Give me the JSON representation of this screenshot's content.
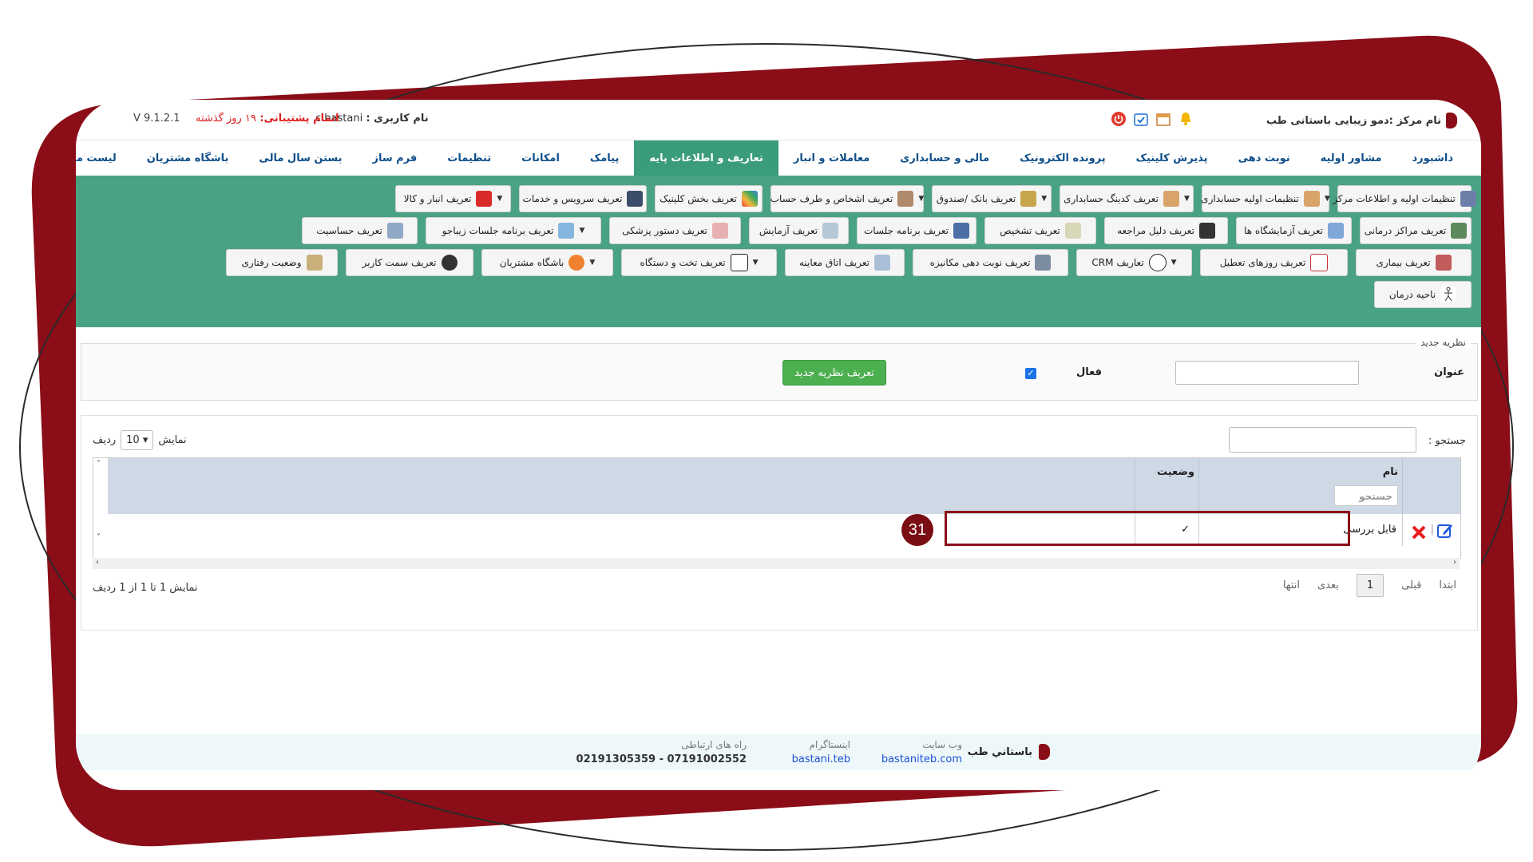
{
  "colors": {
    "brand": "#8b0d17",
    "menu_green": "#4aa285",
    "active_tab": "#3b9c7a",
    "link_blue": "#0f4f8a"
  },
  "topbar": {
    "center_name": "نام مرکز :دمو زیبایی باستانی طب",
    "username_label": "نام کاربری :",
    "username": "c.bastani",
    "support_label": "اتمام پشتیبانی:",
    "support_days": "۱۹ روز گذشته",
    "version": "V 9.1.2.1",
    "icons": [
      "bell-icon",
      "calendar-icon",
      "calendar-check-icon",
      "power-icon"
    ]
  },
  "mainnav": {
    "items": [
      "داشبورد",
      "مشاور اولیه",
      "نوبت دهی",
      "پذیرش کلینیک",
      "پرونده الکترونیک",
      "مالی و حسابداری",
      "معاملات و انبار",
      "تعاریف و اطلاعات پایه",
      "پیامک",
      "امکانات",
      "تنظیمات",
      "فرم ساز",
      "بستن سال مالی",
      "باشگاه مشتریان",
      "لیست ماژول ها"
    ]
  },
  "subnav": {
    "row1": [
      "تنظیمات اولیه و اطلاعات مرکز",
      "تنظیمات اولیه حسابداری",
      "تعریف کدینگ حسابداری",
      "تعریف بانک /صندوق",
      "تعریف اشخاص و طرف حساب",
      "تعریف بخش کلینیک",
      "تعریف سرویس و خدمات",
      "تعریف انبار و کالا"
    ],
    "row2": [
      "تعریف مراکز درمانی",
      "تعریف آزمایشگاه ها",
      "تعریف دلیل مراجعه",
      "تعریف تشخیص",
      "تعریف برنامه جلسات",
      "تعریف آزمایش",
      "تعریف دستور پزشکی",
      "تعریف برنامه جلسات زیباجو",
      "تعریف حساسیت"
    ],
    "row3": [
      "تعریف بیماری",
      "تعریف روزهای تعطیل",
      "تعاریف CRM",
      "تعریف نوبت دهی مکانیزه",
      "تعریف اتاق معاینه",
      "تعریف تخت و دستگاه",
      "باشگاه مشتریان",
      "تعریف سمت کاربر",
      "وضعیت رفتاری"
    ],
    "row4": [
      "ناحیه درمان"
    ]
  },
  "form": {
    "legend": "نظریه جدید",
    "title_label": "عنوان",
    "active_label": "فعال",
    "add_button": "تعریف نظریه جدید"
  },
  "list": {
    "search_label": "جستجو :",
    "show_label": "نمایش",
    "page_size": "10",
    "rows_label": "ردیف",
    "columns": [
      "نام",
      "وضعیت"
    ],
    "column_search_placeholder": "جستجو",
    "rows": [
      {
        "name": "قابل بررسی",
        "status": "✓"
      }
    ],
    "badge": "31",
    "info": "نمایش 1 تا 1 از 1 ردیف",
    "pager": {
      "first": "ابتدا",
      "prev": "قبلی",
      "current": "1",
      "next": "بعدی",
      "last": "انتها"
    }
  },
  "footer": {
    "brand": "باستاني طب",
    "website_label": "وب سایت",
    "website": "bastaniteb.com",
    "instagram_label": "اینستاگرام",
    "instagram": "bastani.teb",
    "contact_label": "راه های ارتباطی",
    "contact": "07191002552 - 02191305359"
  }
}
